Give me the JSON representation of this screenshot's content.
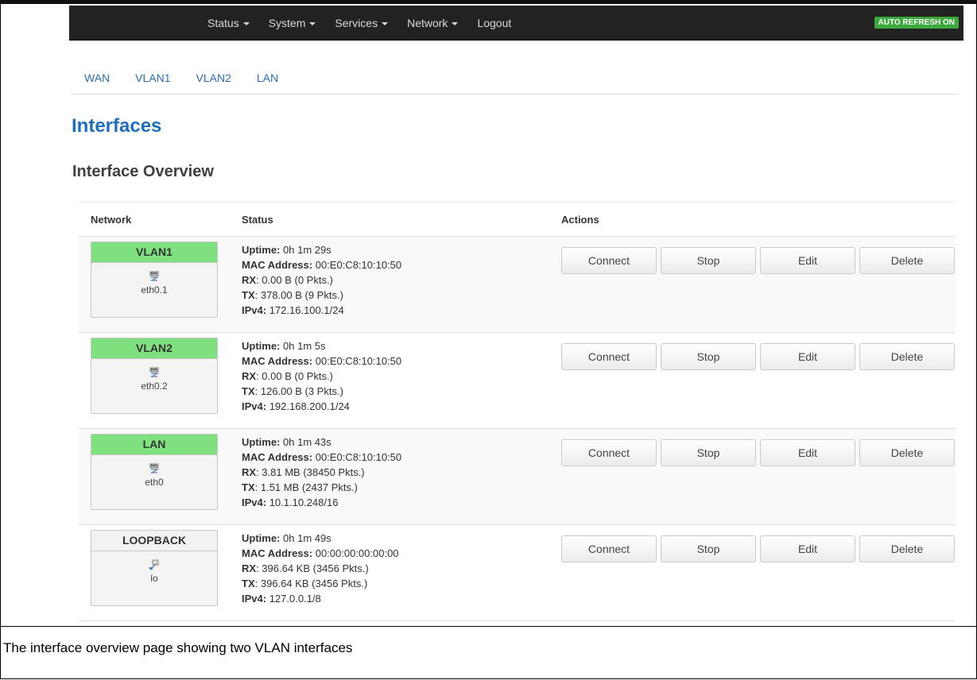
{
  "nav": {
    "menu": [
      {
        "label": "Status",
        "dropdown": true
      },
      {
        "label": "System",
        "dropdown": true
      },
      {
        "label": "Services",
        "dropdown": true
      },
      {
        "label": "Network",
        "dropdown": true
      },
      {
        "label": "Logout",
        "dropdown": false
      }
    ],
    "auto_refresh": "AUTO REFRESH ON"
  },
  "tabs": [
    "WAN",
    "VLAN1",
    "VLAN2",
    "LAN"
  ],
  "page_title": "Interfaces",
  "section_title": "Interface Overview",
  "table": {
    "headers": {
      "network": "Network",
      "status": "Status",
      "actions": "Actions"
    },
    "labels": {
      "uptime": "Uptime:",
      "mac": "MAC Address:",
      "rx": "RX",
      "tx": "TX",
      "ipv4": "IPv4:"
    },
    "buttons": {
      "connect": "Connect",
      "stop": "Stop",
      "edit": "Edit",
      "delete": "Delete"
    },
    "rows": [
      {
        "name": "VLAN1",
        "device": "eth0.1",
        "up": true,
        "uptime": "0h 1m 29s",
        "mac": "00:E0:C8:10:10:50",
        "rx": "0.00 B (0 Pkts.)",
        "tx": "378.00 B (9 Pkts.)",
        "ipv4": "172.16.100.1/24"
      },
      {
        "name": "VLAN2",
        "device": "eth0.2",
        "up": true,
        "uptime": "0h 1m 5s",
        "mac": "00:E0:C8:10:10:50",
        "rx": "0.00 B (0 Pkts.)",
        "tx": "126.00 B (3 Pkts.)",
        "ipv4": "192.168.200.1/24"
      },
      {
        "name": "LAN",
        "device": "eth0",
        "up": true,
        "uptime": "0h 1m 43s",
        "mac": "00:E0:C8:10:10:50",
        "rx": "3.81 MB (38450 Pkts.)",
        "tx": "1.51 MB (2437 Pkts.)",
        "ipv4": "10.1.10.248/16"
      },
      {
        "name": "LOOPBACK",
        "device": "lo",
        "up": false,
        "uptime": "0h 1m 49s",
        "mac": "00:00:00:00:00:00",
        "rx": "396.64 KB (3456 Pkts.)",
        "tx": "396.64 KB (3456 Pkts.)",
        "ipv4": "127.0.0.1/8"
      }
    ]
  },
  "caption": "The interface overview page showing two VLAN interfaces",
  "colors": {
    "up_header": "#7fe07f",
    "down_header": "#f2f2f2",
    "title": "#1e6ebe",
    "link": "#2a6ebb",
    "navbar": "#222222",
    "auto_refresh": "#3ca93c"
  },
  "icons": {
    "ethernet": "ethernet-port-icon",
    "loopback": "loopback-icon",
    "caret": "caret-down-icon"
  }
}
